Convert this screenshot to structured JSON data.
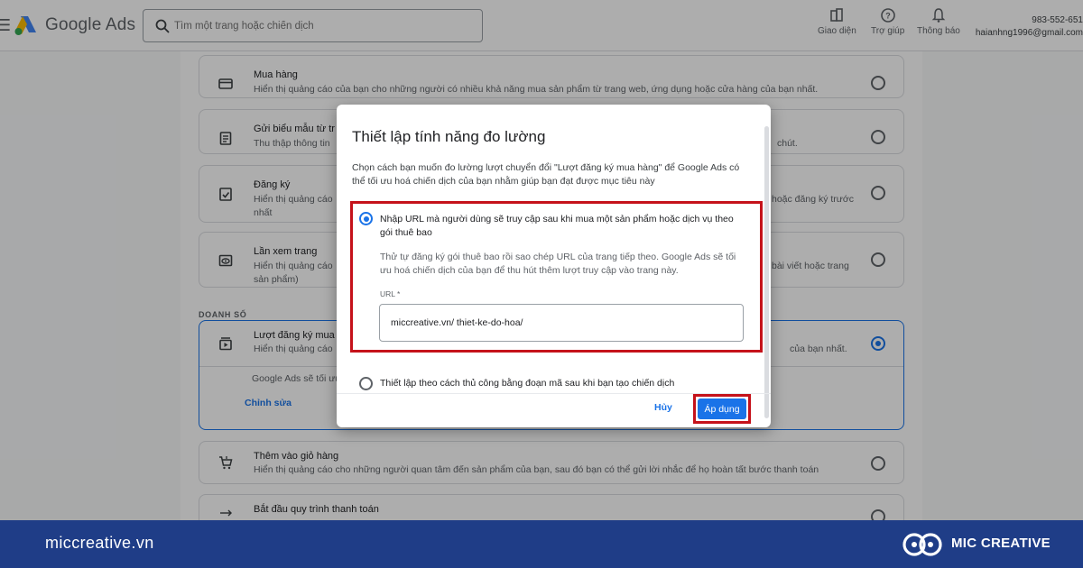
{
  "header": {
    "brand": "Google Ads",
    "search_placeholder": "Tìm một trang hoặc chiến dịch",
    "tools": [
      {
        "label": "Giao diện",
        "icon": "appearance-icon"
      },
      {
        "label": "Trợ giúp",
        "icon": "help-icon"
      },
      {
        "label": "Thông báo",
        "icon": "bell-icon"
      }
    ],
    "account_id": "983-552-651",
    "account_email": "haianhng1996@gmail.com"
  },
  "background": {
    "options": [
      {
        "title": "Mua hàng",
        "desc": "Hiển thị quảng cáo của bạn cho những người có nhiều khả năng mua sản phẩm từ trang web, ứng dụng hoặc cửa hàng của bạn nhất.",
        "icon": "credit-card-icon"
      },
      {
        "title": "Gửi biểu mẫu từ tr",
        "desc": "Thu thập thông tin",
        "desc_tail": "chút.",
        "icon": "form-icon"
      },
      {
        "title": "Đăng ký",
        "desc": "Hiển thị quảng cáo",
        "desc_tail": "hoặc đăng ký trước",
        "desc_line2": "nhất",
        "icon": "signup-icon"
      },
      {
        "title": "Lần xem trang",
        "desc": "Hiển thị quảng cáo",
        "desc_tail": "bài viết hoặc trang",
        "desc_line2": "sản phẩm)",
        "icon": "pageview-icon"
      }
    ],
    "section_label": "DOANH SỐ",
    "selected_option": {
      "title": "Lượt đăng ký mua",
      "desc": "Hiển thị quảng cáo",
      "desc_tail": "của bạn nhất.",
      "sub_text": "Google Ads sẽ tối ưu",
      "edit_label": "Chỉnh sửa",
      "icon": "subscription-icon"
    },
    "options_after": [
      {
        "title": "Thêm vào giỏ hàng",
        "desc": "Hiển thị quảng cáo cho những người quan tâm đến sản phẩm của bạn, sau đó bạn có thể gửi lời nhắc để họ hoàn tất bước thanh toán",
        "icon": "cart-icon"
      },
      {
        "title": "Bắt đầu quy trình thanh toán",
        "icon": "checkout-icon"
      }
    ]
  },
  "dialog": {
    "title": "Thiết lập tính năng đo lường",
    "intro": "Chọn cách bạn muốn đo lường lượt chuyển đổi \"Lượt đăng ký mua hàng\" để Google Ads có thể tối ưu hoá chiến dịch của bạn nhằm giúp bạn đạt được mục tiêu này",
    "option1_label": "Nhập URL mà người dùng sẽ truy cập sau khi mua một sản phẩm hoặc dịch vụ theo gói thuê bao",
    "option1_help": "Thử tự đăng ký gói thuê bao rồi sao chép URL của trang tiếp theo. Google Ads sẽ tối ưu hoá chiến dịch của bạn để thu hút thêm lượt truy cập vào trang này.",
    "url_label": "URL *",
    "url_value": "miccreative.vn/ thiet-ke-do-hoa/",
    "option2_label": "Thiết lập theo cách thủ công bằng đoạn mã sau khi bạn tạo chiến dịch",
    "cancel_label": "Hủy",
    "apply_label": "Áp dụng",
    "highlight_color": "#c5121a"
  },
  "footer": {
    "site": "miccreative.vn",
    "company": "MIC CREATIVE",
    "bg_color": "#1f3d87"
  }
}
